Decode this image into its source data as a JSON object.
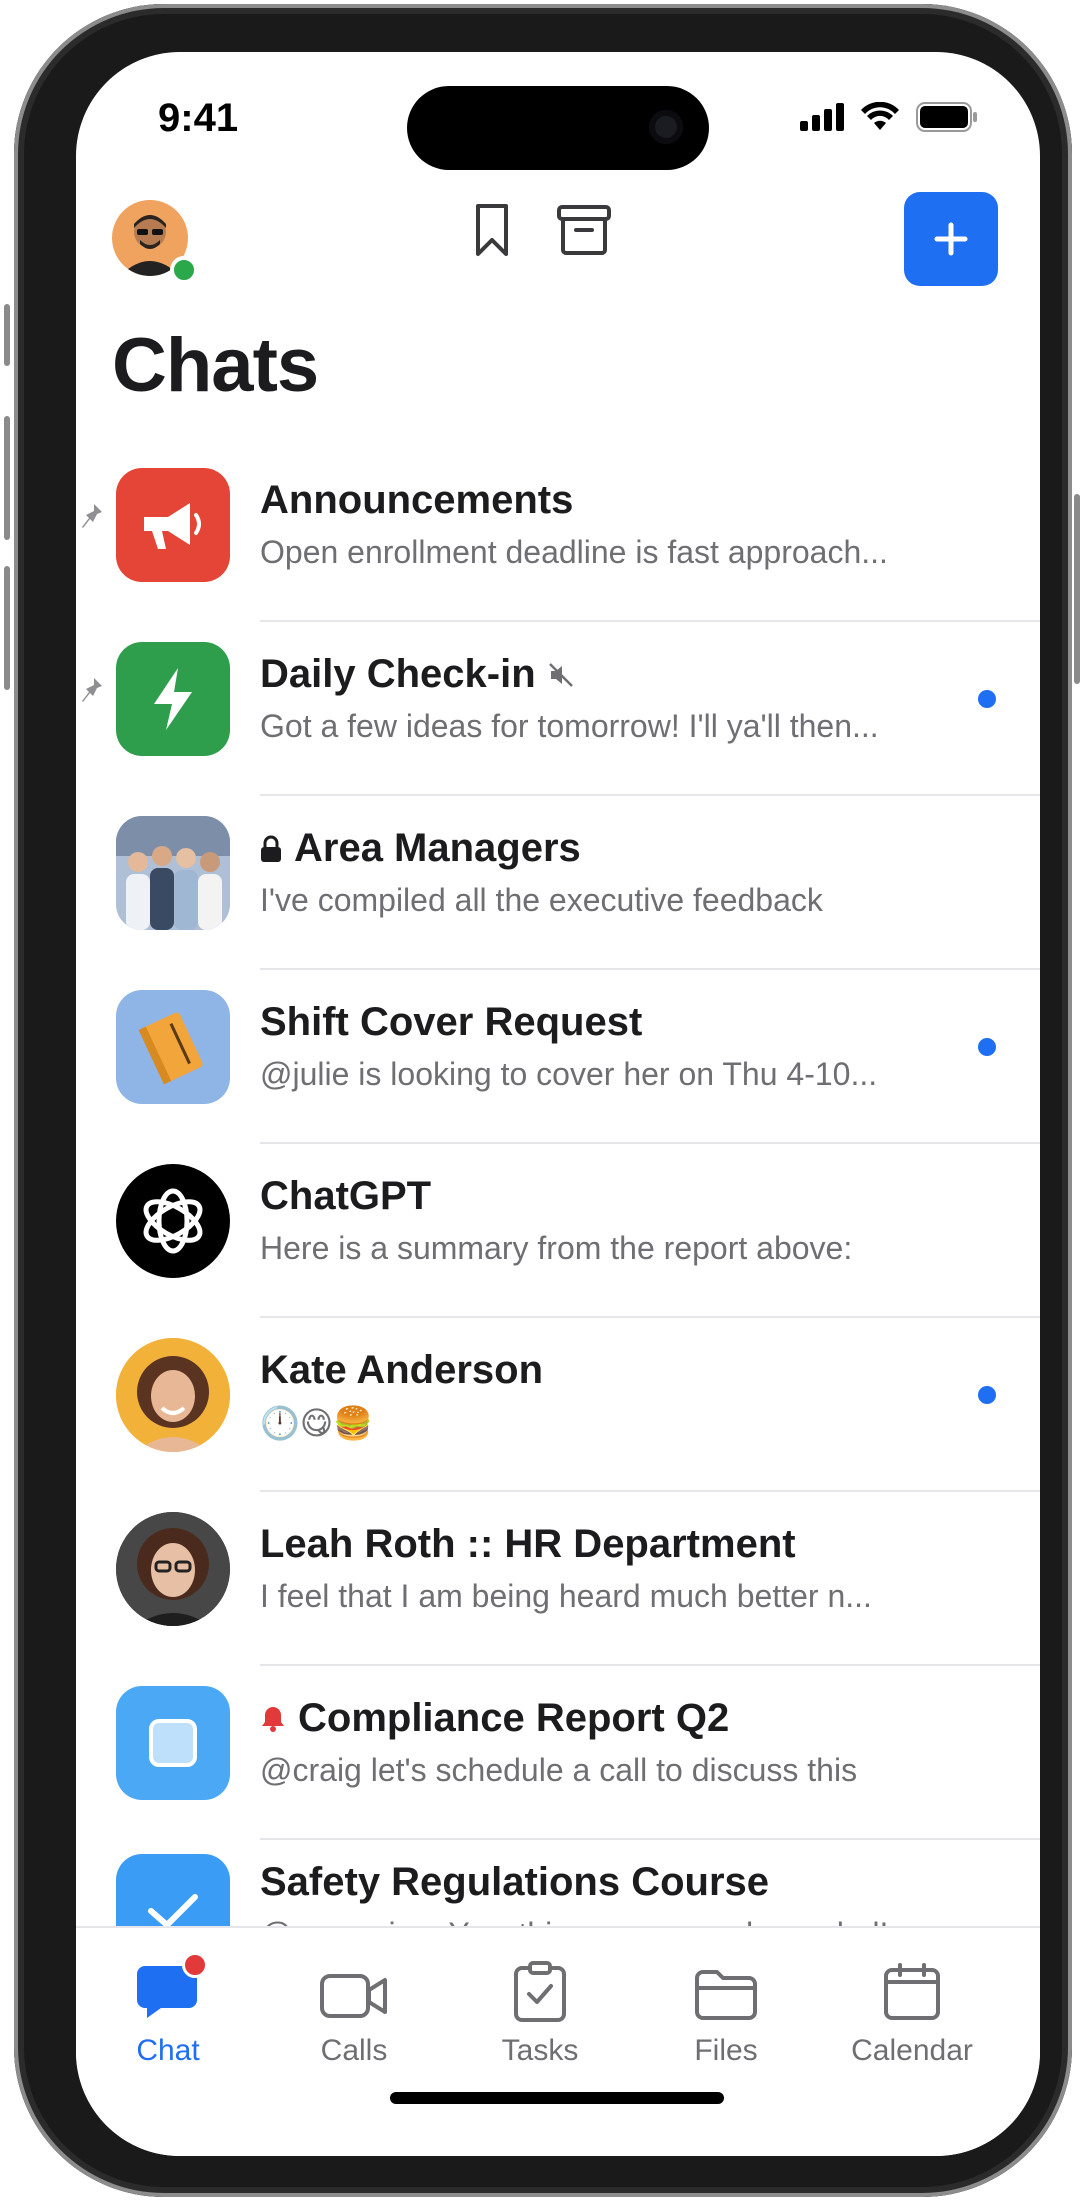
{
  "status_bar": {
    "time": "9:41"
  },
  "header": {
    "title": "Chats"
  },
  "colors": {
    "accent": "#1f6ff2",
    "unread_dot": "#1f6ff2",
    "presence_online": "#2aa84a",
    "badge": "#e23a3a"
  },
  "chats": [
    {
      "name": "Announcements",
      "preview": "Open enrollment deadline is fast approach...",
      "pinned": true,
      "icon": "megaphone-icon"
    },
    {
      "name": "Daily Check-in",
      "preview": "Got a few ideas for tomorrow! I'll ya'll then...",
      "pinned": true,
      "muted": true,
      "unread": true,
      "icon": "lightning-icon"
    },
    {
      "name": "Area Managers",
      "preview": "I've compiled all the executive feedback",
      "private": true,
      "icon": "group-photo"
    },
    {
      "name": "Shift Cover Request",
      "preview": "@julie is looking to cover her on Thu 4-10...",
      "unread": true,
      "icon": "notebook-icon"
    },
    {
      "name": "ChatGPT",
      "preview": "Here is a summary from the report above:",
      "icon": "openai-logo"
    },
    {
      "name": "Kate Anderson",
      "preview": "🕛😋🍔",
      "unread": true,
      "icon": "avatar-kate"
    },
    {
      "name": "Leah Roth :: HR Department",
      "preview": "I feel that I am being heard much better n...",
      "icon": "avatar-leah"
    },
    {
      "name": "Compliance Report Q2",
      "preview": "@craig let's schedule a call to discuss this",
      "alert": true,
      "icon": "square-icon"
    },
    {
      "name": "Safety Regulations Course",
      "preview": "@supervisor Yes, this was so much needed!",
      "icon": "checkmark-icon"
    }
  ],
  "tabs": [
    {
      "label": "Chat",
      "icon": "chat-bubble-icon",
      "active": true
    },
    {
      "label": "Calls",
      "icon": "video-camera-icon"
    },
    {
      "label": "Tasks",
      "icon": "clipboard-check-icon"
    },
    {
      "label": "Files",
      "icon": "folder-icon"
    },
    {
      "label": "Calendar",
      "icon": "calendar-icon"
    }
  ]
}
